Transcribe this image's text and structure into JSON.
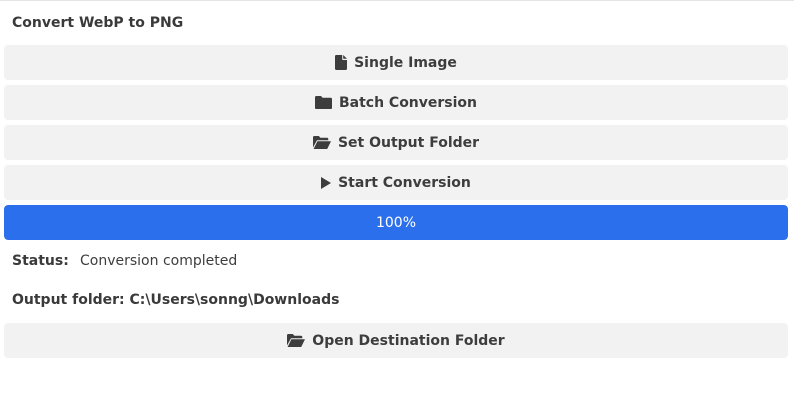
{
  "app": {
    "title": "Convert WebP to PNG"
  },
  "buttons": {
    "single_image": {
      "label": "Single Image",
      "icon": "file-icon"
    },
    "batch_conversion": {
      "label": "Batch Conversion",
      "icon": "folder-icon"
    },
    "set_output_folder": {
      "label": "Set Output Folder",
      "icon": "folder-open-icon"
    },
    "start_conversion": {
      "label": "Start Conversion",
      "icon": "play-icon"
    },
    "open_destination_folder": {
      "label": "Open Destination Folder",
      "icon": "folder-open-icon"
    }
  },
  "progress": {
    "value": 1.0,
    "text": "100%",
    "color": "#2c6fed"
  },
  "status": {
    "label": "Status:",
    "value": "Conversion completed"
  },
  "output": {
    "text": "Output folder: C:\\Users\\sonng\\Downloads"
  }
}
